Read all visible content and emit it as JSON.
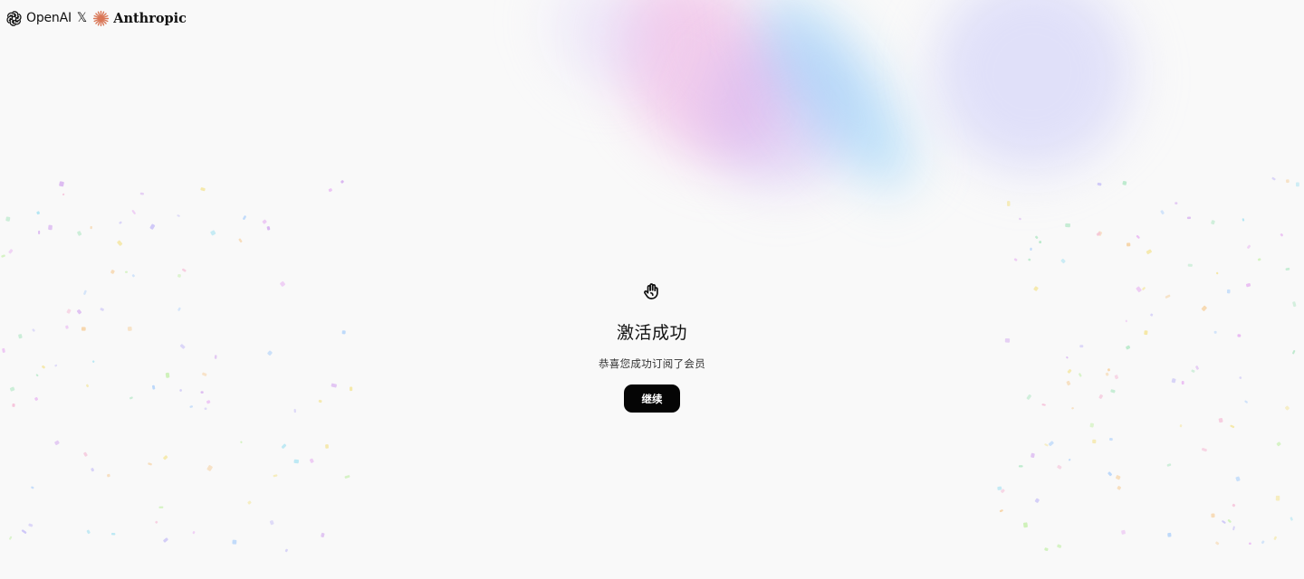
{
  "brand": {
    "left": "OpenAI",
    "separator": "𝕏",
    "right": "Anthropic",
    "left_icon": "openai-logo-icon",
    "right_icon": "anthropic-logo-icon"
  },
  "success": {
    "icon": "hand-icon",
    "title": "激活成功",
    "message": "恭喜您成功订阅了会员",
    "button_label": "继续"
  },
  "colors": {
    "background": "#f9f9f9",
    "button": "#050505",
    "button_text": "#ffffff",
    "anthropic_accent": "#d97757"
  }
}
